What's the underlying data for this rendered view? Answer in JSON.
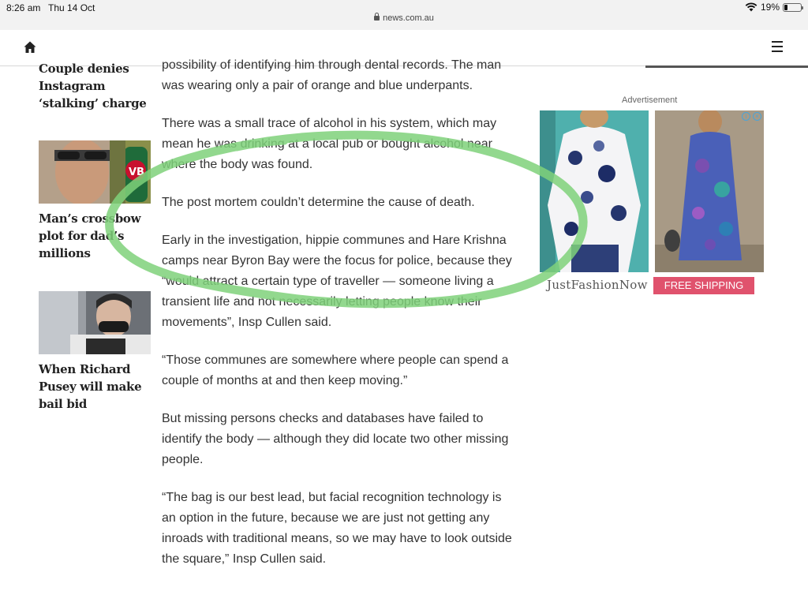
{
  "status_bar": {
    "time": "8:26 am",
    "date": "Thu 14 Oct",
    "battery": "19%"
  },
  "browser": {
    "url": "news.com.au"
  },
  "related_stories": [
    {
      "title": "Couple denies Instagram ‘stalking’ charge"
    },
    {
      "title": "Man’s crossbow plot for dad’s millions",
      "thumb_text": "VB"
    },
    {
      "title": "When Richard Pusey will make bail bid"
    }
  ],
  "article": {
    "paragraphs": [
      "possibility of identifying him through dental records. The man was wearing only a pair of orange and blue underpants.",
      "There was a small trace of alcohol in his system, which may mean he was drinking at a local pub or bought alcohol near where the body was found.",
      "The post mortem couldn’t determine the cause of death.",
      "Early in the investigation, hippie communes and Hare Krishna camps near Byron Bay were the focus for police, because they “would attract a certain type of traveller — someone living a transient life and not necessarily letting people know their movements”, Insp Cullen said.",
      "“Those communes are somewhere where people can spend a couple of months at and then keep moving.”",
      "But missing persons checks and databases have failed to identify the body — although they did locate two other missing people.",
      "“The bag is our best lead, but facial recognition technology is an option in the future, because we are just not getting any inroads with traditional means, so we may have to look outside the square,” Insp Cullen said."
    ]
  },
  "advertisement": {
    "label": "Advertisement",
    "brand": "JustFashionNow",
    "cta": "FREE SHIPPING",
    "colors": {
      "cta_bg": "#e0526d"
    }
  },
  "annotation": {
    "color": "#7fd17a"
  }
}
